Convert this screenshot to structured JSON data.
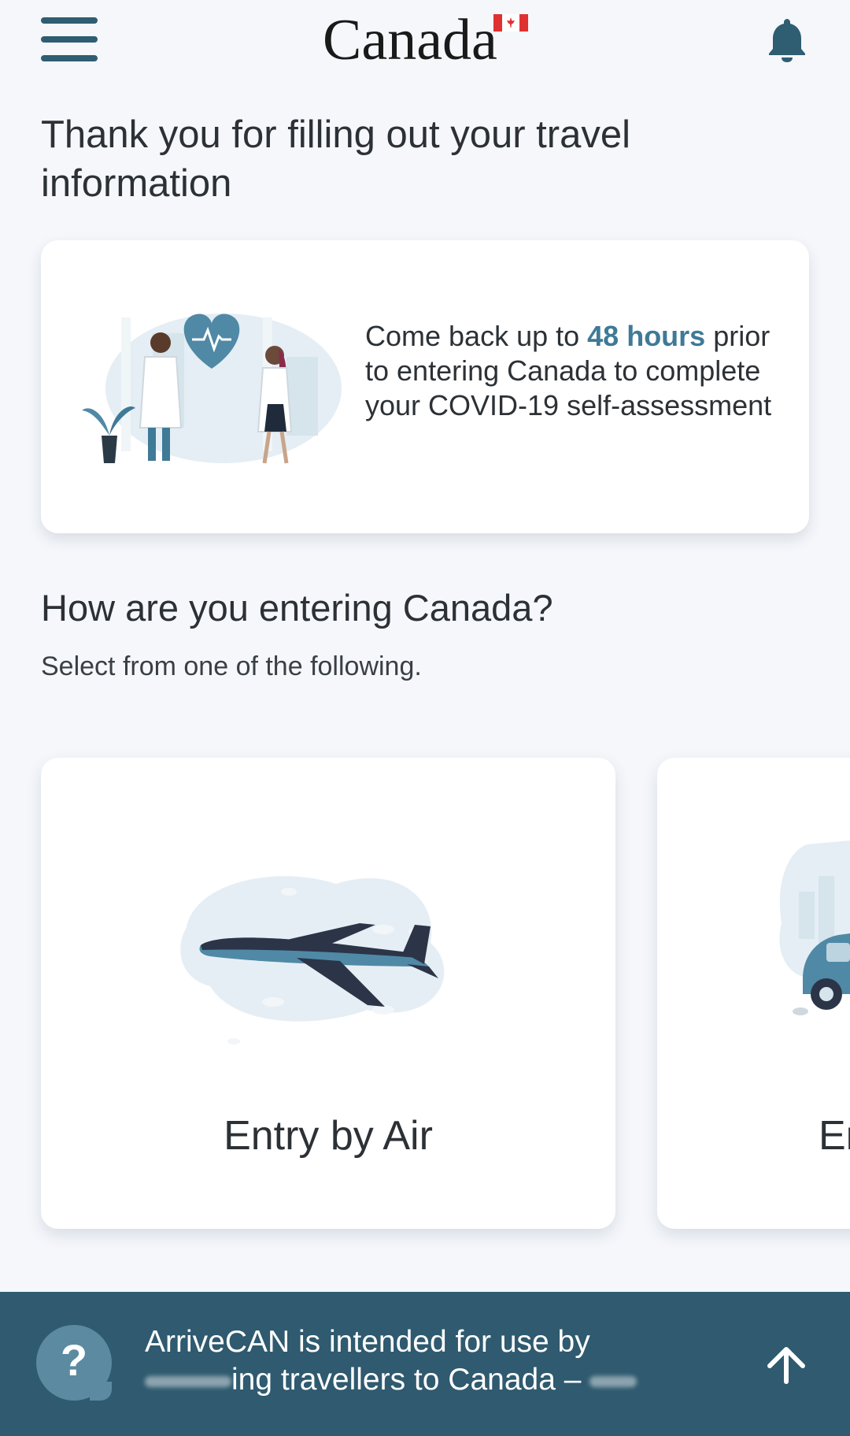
{
  "header": {
    "menu_icon": "hamburger-menu-icon",
    "wordmark": "Canada",
    "notification_icon": "bell-icon"
  },
  "page": {
    "title": "Thank you for filling out your travel information"
  },
  "info_card": {
    "text_before": "Come back up to ",
    "highlight": "48 hours",
    "text_after": " prior to entering Canada to complete your COVID-19 self-assessment",
    "highlight_color": "#3f7a97"
  },
  "entry_section": {
    "heading": "How are you entering Canada?",
    "subheading": "Select from one of the following.",
    "options": [
      {
        "label": "Entry by Air",
        "icon": "airplane-illustration"
      },
      {
        "label": "En",
        "icon": "car-illustration"
      }
    ]
  },
  "footer": {
    "help_icon": "help-question-icon",
    "line1": "ArriveCAN is intended for use by",
    "line2": "ing travellers to Canada –",
    "expand_icon": "chevron-up-icon",
    "background": "#2f5a6f"
  },
  "colors": {
    "accent": "#2f5d72",
    "background": "#f5f7fb",
    "card": "#ffffff",
    "text": "#2c3136"
  }
}
